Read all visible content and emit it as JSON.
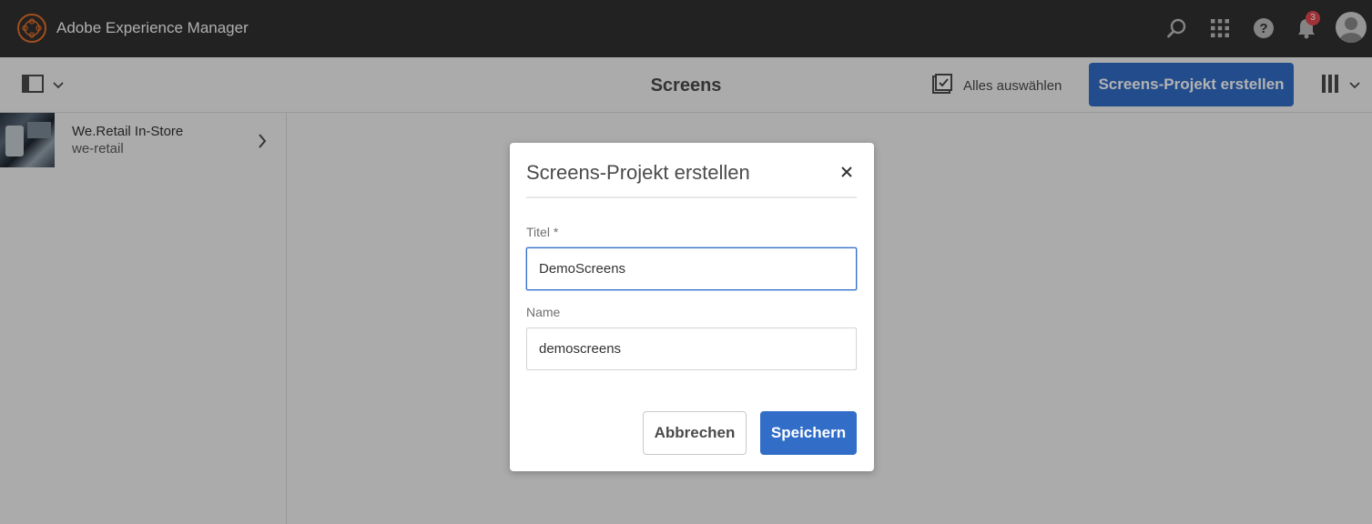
{
  "globalnav": {
    "brand": "Adobe Experience Manager",
    "notification_count": "3"
  },
  "actionbar": {
    "title": "Screens",
    "select_all_label": "Alles auswählen",
    "create_button_label": "Screens-Projekt erstellen"
  },
  "column": {
    "items": [
      {
        "title": "We.Retail In-Store",
        "subtitle": "we-retail"
      }
    ]
  },
  "dialog": {
    "title": "Screens-Projekt erstellen",
    "fields": {
      "title_label": "Titel *",
      "title_value": "DemoScreens",
      "name_label": "Name",
      "name_value": "demoscreens"
    },
    "cancel_label": "Abbrechen",
    "save_label": "Speichern"
  },
  "colors": {
    "header_bg": "#323232",
    "accent": "#326ec8",
    "page_bg": "#f5f5f5"
  }
}
